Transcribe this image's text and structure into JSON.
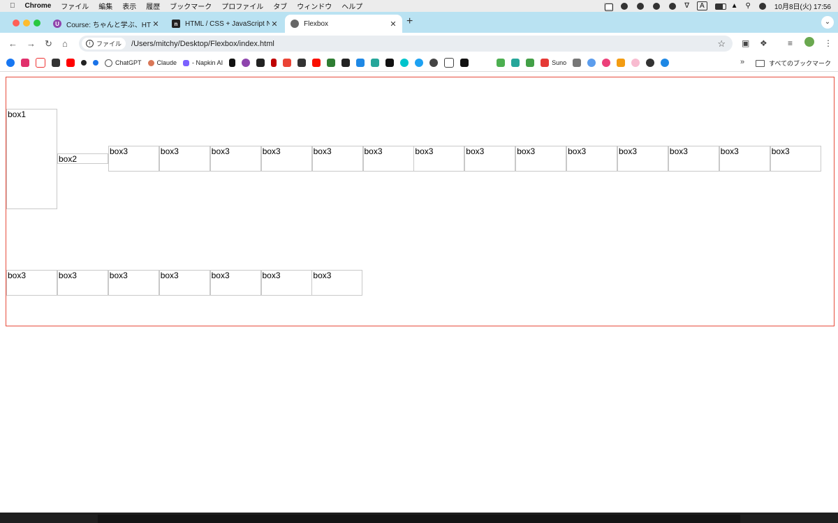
{
  "menubar": {
    "app_name": "Chrome",
    "items": [
      "ファイル",
      "編集",
      "表示",
      "履歴",
      "ブックマーク",
      "プロファイル",
      "タブ",
      "ウィンドウ",
      "ヘルプ"
    ],
    "input_indicator": "A",
    "datetime": "10月8日(火)  17:56"
  },
  "tabs": [
    {
      "title": "Course: ちゃんと学ぶ、HTML/CSS",
      "favicon_color": "#8e44ad",
      "favicon_letter": "U",
      "active": false
    },
    {
      "title": "HTML / CSS + JavaScript Notion",
      "favicon_color": "#222222",
      "favicon_letter": "n",
      "active": false
    },
    {
      "title": "Flexbox",
      "favicon_color": "#666666",
      "favicon_letter": "",
      "active": true
    }
  ],
  "toolbar": {
    "chip_label": "ファイル",
    "url": "/Users/mitchy/Desktop/Flexbox/index.html"
  },
  "bookmarks": {
    "named": [
      {
        "label": "ChatGPT",
        "color": "#555555"
      },
      {
        "label": "Claude",
        "color": "#d97757"
      },
      {
        "label": "- Napkin AI",
        "color": "#7b61ff"
      },
      {
        "label": "Suno",
        "color": "#777777"
      }
    ],
    "folder_label": "すべてのブックマーク"
  },
  "page": {
    "box1_label": "box1",
    "box2_label": "box2",
    "row1": [
      "box3",
      "box3",
      "box3",
      "box3",
      "box3",
      "box3",
      "box3",
      "box3",
      "box3",
      "box3",
      "box3",
      "box3",
      "box3",
      "box3"
    ],
    "row2": [
      "box3",
      "box3",
      "box3",
      "box3",
      "box3",
      "box3",
      "box3"
    ]
  },
  "colors": {
    "container_border": "#e74c3c",
    "tabstrip_bg": "#b9e2f2",
    "box_border": "#c9c9c9"
  }
}
